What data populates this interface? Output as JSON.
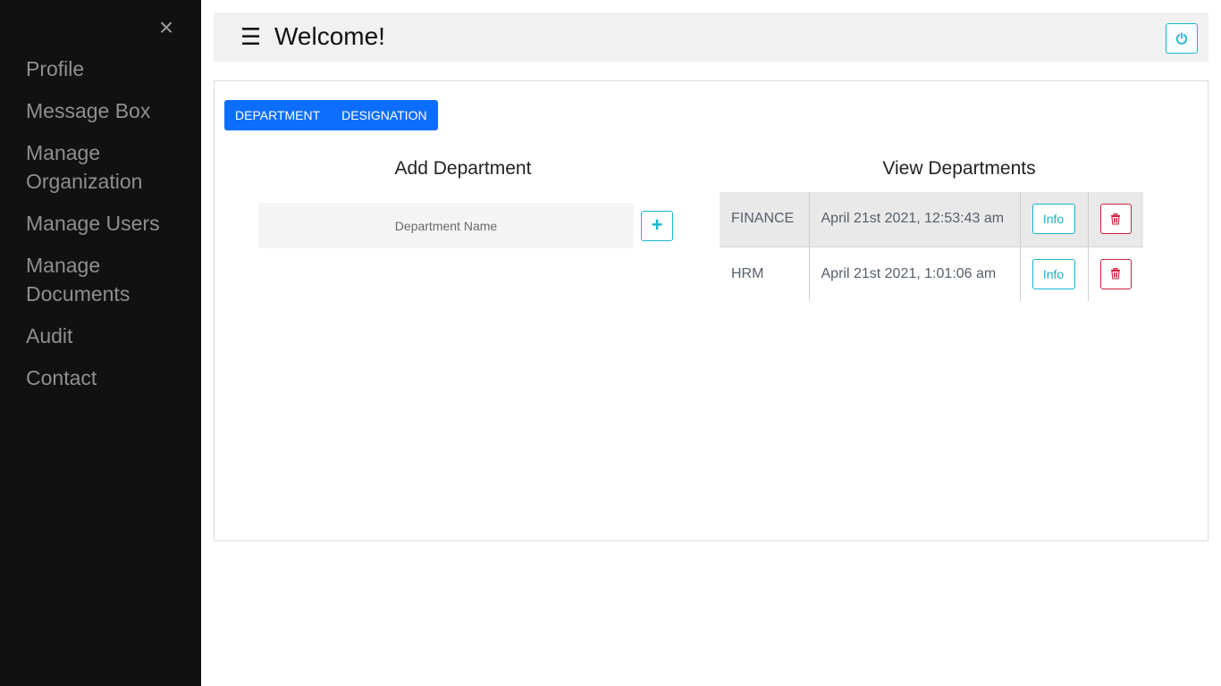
{
  "sidebar": {
    "close_icon": "×",
    "items": [
      {
        "label": "Profile"
      },
      {
        "label": "Message Box"
      },
      {
        "label": "Manage Organization"
      },
      {
        "label": "Manage Users"
      },
      {
        "label": "Manage Documents"
      },
      {
        "label": "Audit"
      },
      {
        "label": "Contact"
      }
    ]
  },
  "header": {
    "menu_icon": "☰",
    "title": "Welcome!",
    "power_icon": "power-icon"
  },
  "tabs": [
    {
      "label": "DEPARTMENT"
    },
    {
      "label": "DESIGNATION"
    }
  ],
  "add_department": {
    "title": "Add Department",
    "placeholder": "Department Name",
    "value": "",
    "add_icon": "+"
  },
  "view_departments": {
    "title": "View Departments",
    "rows": [
      {
        "name": "FINANCE",
        "created": "April 21st 2021, 12:53:43 am",
        "info_label": "Info"
      },
      {
        "name": "HRM",
        "created": "April 21st 2021, 1:01:06 am",
        "info_label": "Info"
      }
    ]
  },
  "colors": {
    "sidebar_bg": "#111111",
    "accent_blue": "#0d6efd",
    "accent_cyan": "#17b6cf",
    "danger": "#d0203a",
    "header_bg": "#f1f1f1"
  }
}
